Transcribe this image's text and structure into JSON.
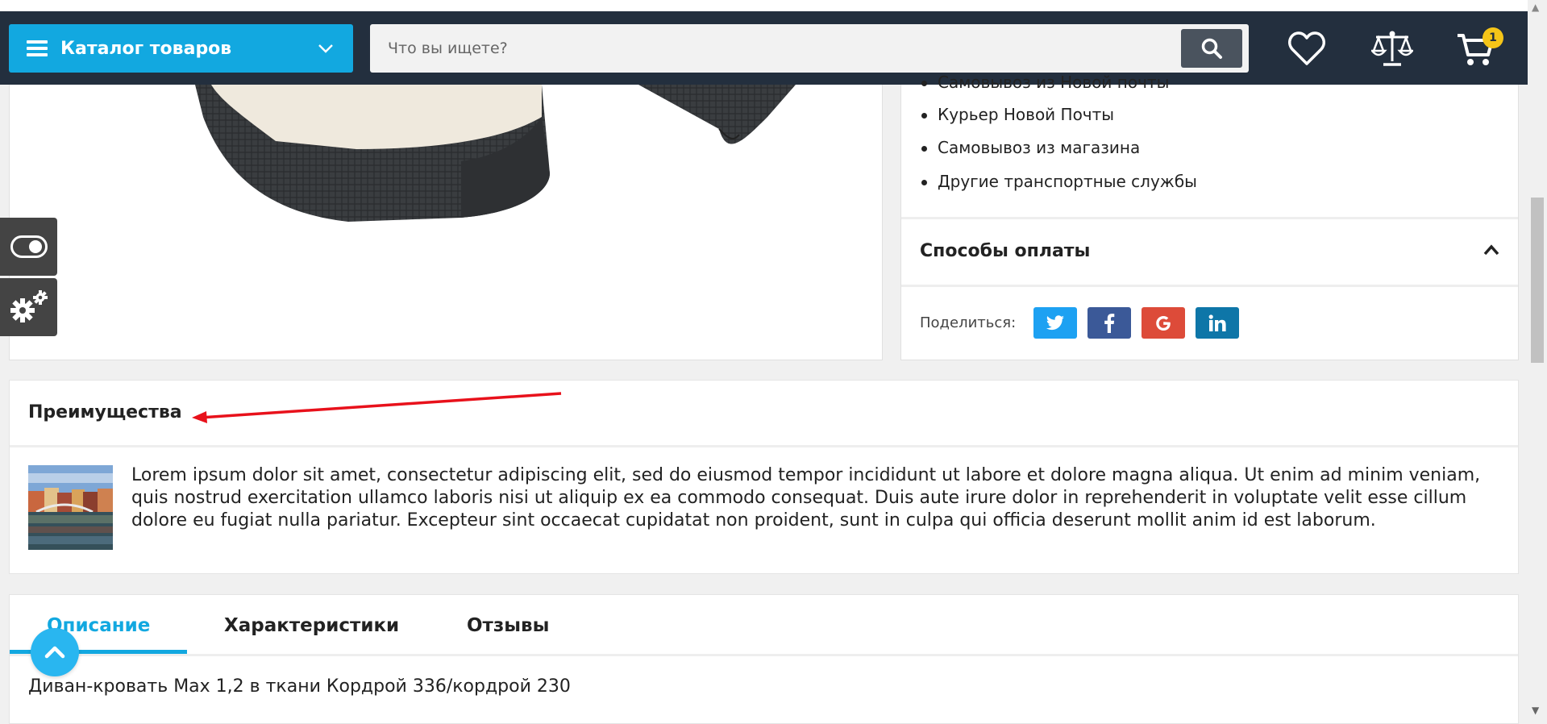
{
  "header": {
    "catalog_label": "Каталог товаров",
    "search_placeholder": "Что вы ищете?",
    "cart_count": "1",
    "icons": [
      "menu-icon",
      "chevron-down-icon",
      "search-icon",
      "heart-icon",
      "scales-icon",
      "cart-icon"
    ]
  },
  "delivery": {
    "items": [
      "Самовывоз из Новой почты",
      "Курьер Новой Почты",
      "Самовывоз из магазина",
      "Другие транспортные службы"
    ]
  },
  "payment": {
    "title": "Способы оплаты"
  },
  "share": {
    "label": "Поделиться:",
    "networks": [
      {
        "name": "twitter",
        "color": "#1da1f2"
      },
      {
        "name": "facebook",
        "color": "#3b5998"
      },
      {
        "name": "google",
        "color": "#dd4b39"
      },
      {
        "name": "linkedin",
        "color": "#0e76a8"
      }
    ]
  },
  "advantages": {
    "title": "Преимущества",
    "text": "Lorem ipsum dolor sit amet, consectetur adipiscing elit, sed do eiusmod tempor incididunt ut labore et dolore magna aliqua. Ut enim ad minim veniam, quis nostrud exercitation ullamco laboris nisi ut aliquip ex ea commodo consequat. Duis aute irure dolor in reprehenderit in voluptate velit esse cillum dolore eu fugiat nulla pariatur. Excepteur sint occaecat cupidatat non proident, sunt in culpa qui officia deserunt mollit anim id est laborum."
  },
  "tabs": {
    "items": [
      {
        "label": "Описание",
        "active": true
      },
      {
        "label": "Характеристики",
        "active": false
      },
      {
        "label": "Отзывы",
        "active": false
      }
    ],
    "description": "Диван-кровать Max 1,2  в ткани Кордрой 336/кордрой 230"
  },
  "colors": {
    "header_bg": "#232f3e",
    "accent": "#12a8e0",
    "cart_badge": "#f5c518",
    "annotation": "#e8111b"
  }
}
